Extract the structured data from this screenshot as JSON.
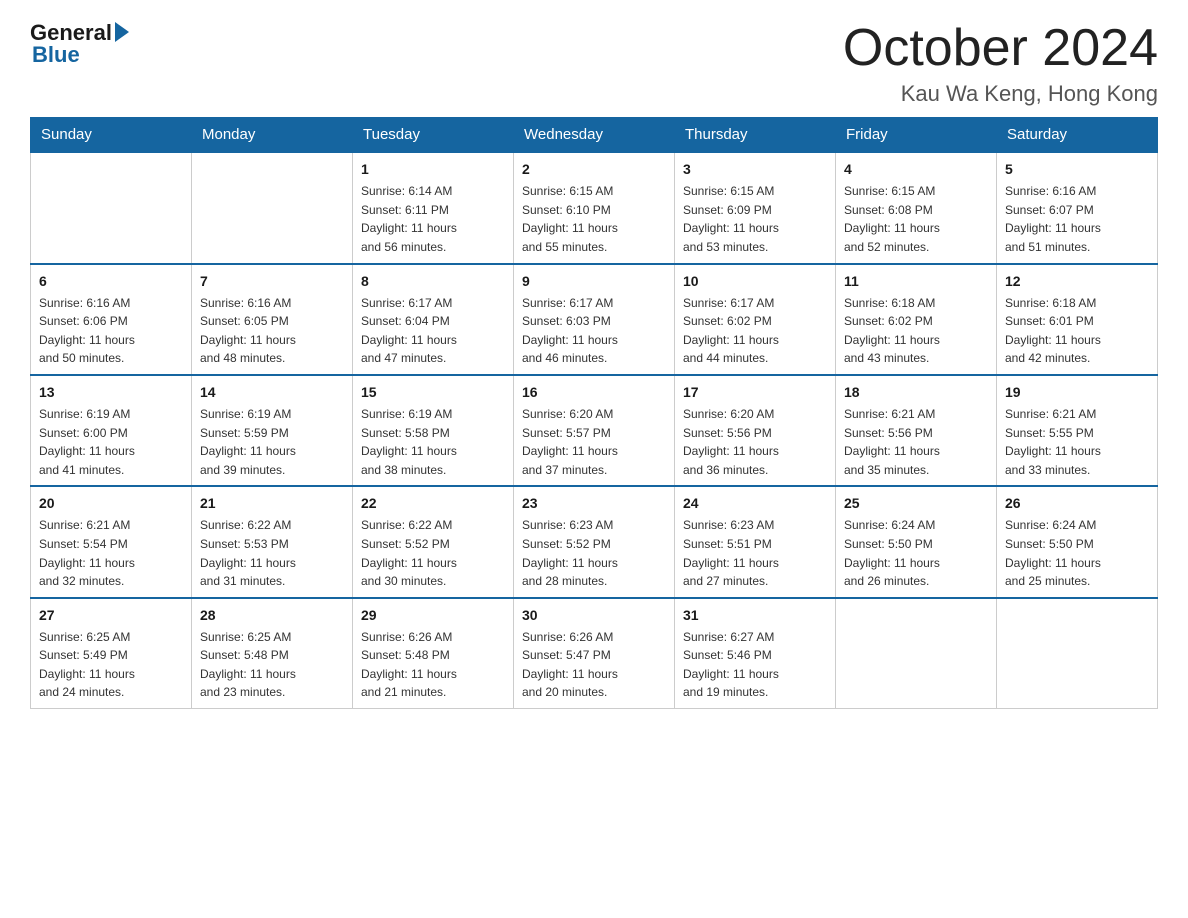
{
  "logo": {
    "general": "General",
    "blue": "Blue"
  },
  "title": "October 2024",
  "location": "Kau Wa Keng, Hong Kong",
  "days_of_week": [
    "Sunday",
    "Monday",
    "Tuesday",
    "Wednesday",
    "Thursday",
    "Friday",
    "Saturday"
  ],
  "weeks": [
    [
      {
        "day": "",
        "info": ""
      },
      {
        "day": "",
        "info": ""
      },
      {
        "day": "1",
        "info": "Sunrise: 6:14 AM\nSunset: 6:11 PM\nDaylight: 11 hours\nand 56 minutes."
      },
      {
        "day": "2",
        "info": "Sunrise: 6:15 AM\nSunset: 6:10 PM\nDaylight: 11 hours\nand 55 minutes."
      },
      {
        "day": "3",
        "info": "Sunrise: 6:15 AM\nSunset: 6:09 PM\nDaylight: 11 hours\nand 53 minutes."
      },
      {
        "day": "4",
        "info": "Sunrise: 6:15 AM\nSunset: 6:08 PM\nDaylight: 11 hours\nand 52 minutes."
      },
      {
        "day": "5",
        "info": "Sunrise: 6:16 AM\nSunset: 6:07 PM\nDaylight: 11 hours\nand 51 minutes."
      }
    ],
    [
      {
        "day": "6",
        "info": "Sunrise: 6:16 AM\nSunset: 6:06 PM\nDaylight: 11 hours\nand 50 minutes."
      },
      {
        "day": "7",
        "info": "Sunrise: 6:16 AM\nSunset: 6:05 PM\nDaylight: 11 hours\nand 48 minutes."
      },
      {
        "day": "8",
        "info": "Sunrise: 6:17 AM\nSunset: 6:04 PM\nDaylight: 11 hours\nand 47 minutes."
      },
      {
        "day": "9",
        "info": "Sunrise: 6:17 AM\nSunset: 6:03 PM\nDaylight: 11 hours\nand 46 minutes."
      },
      {
        "day": "10",
        "info": "Sunrise: 6:17 AM\nSunset: 6:02 PM\nDaylight: 11 hours\nand 44 minutes."
      },
      {
        "day": "11",
        "info": "Sunrise: 6:18 AM\nSunset: 6:02 PM\nDaylight: 11 hours\nand 43 minutes."
      },
      {
        "day": "12",
        "info": "Sunrise: 6:18 AM\nSunset: 6:01 PM\nDaylight: 11 hours\nand 42 minutes."
      }
    ],
    [
      {
        "day": "13",
        "info": "Sunrise: 6:19 AM\nSunset: 6:00 PM\nDaylight: 11 hours\nand 41 minutes."
      },
      {
        "day": "14",
        "info": "Sunrise: 6:19 AM\nSunset: 5:59 PM\nDaylight: 11 hours\nand 39 minutes."
      },
      {
        "day": "15",
        "info": "Sunrise: 6:19 AM\nSunset: 5:58 PM\nDaylight: 11 hours\nand 38 minutes."
      },
      {
        "day": "16",
        "info": "Sunrise: 6:20 AM\nSunset: 5:57 PM\nDaylight: 11 hours\nand 37 minutes."
      },
      {
        "day": "17",
        "info": "Sunrise: 6:20 AM\nSunset: 5:56 PM\nDaylight: 11 hours\nand 36 minutes."
      },
      {
        "day": "18",
        "info": "Sunrise: 6:21 AM\nSunset: 5:56 PM\nDaylight: 11 hours\nand 35 minutes."
      },
      {
        "day": "19",
        "info": "Sunrise: 6:21 AM\nSunset: 5:55 PM\nDaylight: 11 hours\nand 33 minutes."
      }
    ],
    [
      {
        "day": "20",
        "info": "Sunrise: 6:21 AM\nSunset: 5:54 PM\nDaylight: 11 hours\nand 32 minutes."
      },
      {
        "day": "21",
        "info": "Sunrise: 6:22 AM\nSunset: 5:53 PM\nDaylight: 11 hours\nand 31 minutes."
      },
      {
        "day": "22",
        "info": "Sunrise: 6:22 AM\nSunset: 5:52 PM\nDaylight: 11 hours\nand 30 minutes."
      },
      {
        "day": "23",
        "info": "Sunrise: 6:23 AM\nSunset: 5:52 PM\nDaylight: 11 hours\nand 28 minutes."
      },
      {
        "day": "24",
        "info": "Sunrise: 6:23 AM\nSunset: 5:51 PM\nDaylight: 11 hours\nand 27 minutes."
      },
      {
        "day": "25",
        "info": "Sunrise: 6:24 AM\nSunset: 5:50 PM\nDaylight: 11 hours\nand 26 minutes."
      },
      {
        "day": "26",
        "info": "Sunrise: 6:24 AM\nSunset: 5:50 PM\nDaylight: 11 hours\nand 25 minutes."
      }
    ],
    [
      {
        "day": "27",
        "info": "Sunrise: 6:25 AM\nSunset: 5:49 PM\nDaylight: 11 hours\nand 24 minutes."
      },
      {
        "day": "28",
        "info": "Sunrise: 6:25 AM\nSunset: 5:48 PM\nDaylight: 11 hours\nand 23 minutes."
      },
      {
        "day": "29",
        "info": "Sunrise: 6:26 AM\nSunset: 5:48 PM\nDaylight: 11 hours\nand 21 minutes."
      },
      {
        "day": "30",
        "info": "Sunrise: 6:26 AM\nSunset: 5:47 PM\nDaylight: 11 hours\nand 20 minutes."
      },
      {
        "day": "31",
        "info": "Sunrise: 6:27 AM\nSunset: 5:46 PM\nDaylight: 11 hours\nand 19 minutes."
      },
      {
        "day": "",
        "info": ""
      },
      {
        "day": "",
        "info": ""
      }
    ]
  ]
}
